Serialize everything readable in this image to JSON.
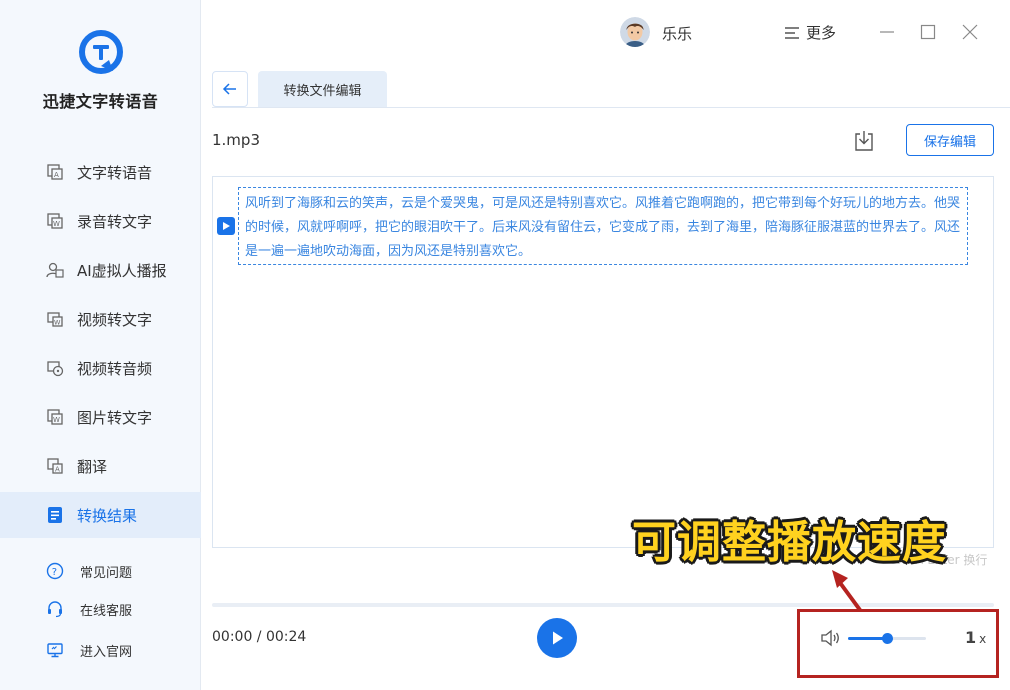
{
  "app": {
    "name": "迅捷文字转语音"
  },
  "sidebar": {
    "items": [
      {
        "label": "文字转语音"
      },
      {
        "label": "录音转文字"
      },
      {
        "label": "AI虚拟人播报"
      },
      {
        "label": "视频转文字"
      },
      {
        "label": "视频转音频"
      },
      {
        "label": "图片转文字"
      },
      {
        "label": "翻译"
      },
      {
        "label": "转换结果",
        "active": true
      }
    ],
    "footer": [
      {
        "label": "常见问题"
      },
      {
        "label": "在线客服"
      },
      {
        "label": "进入官网"
      }
    ]
  },
  "header": {
    "username": "乐乐",
    "more_label": "更多"
  },
  "tabs": [
    {
      "label": "转换文件编辑"
    }
  ],
  "file": {
    "name": "1.mp3"
  },
  "toolbar": {
    "save_label": "保存编辑"
  },
  "editor": {
    "segment_text": "风听到了海豚和云的笑声，云是个爱哭鬼，可是风还是特别喜欢它。风推着它跑啊跑的，把它带到每个好玩儿的地方去。他哭的时候，风就呼啊呼，把它的眼泪吹干了。后来风没有留住云，它变成了雨，去到了海里，陪海豚征服湛蓝的世界去了。风还是一遍一遍地吹动海面，因为风还是特别喜欢它。",
    "hint": "Shift+Enter 换行"
  },
  "player": {
    "time": "00:00 / 00:24",
    "progress": 0,
    "volume": 0.5,
    "speed_value": "1",
    "speed_unit": "x"
  },
  "annotation": {
    "text": "可调整播放速度"
  },
  "colors": {
    "accent": "#1a73e8",
    "annotation": "#ffd21f",
    "box": "#b52320"
  }
}
